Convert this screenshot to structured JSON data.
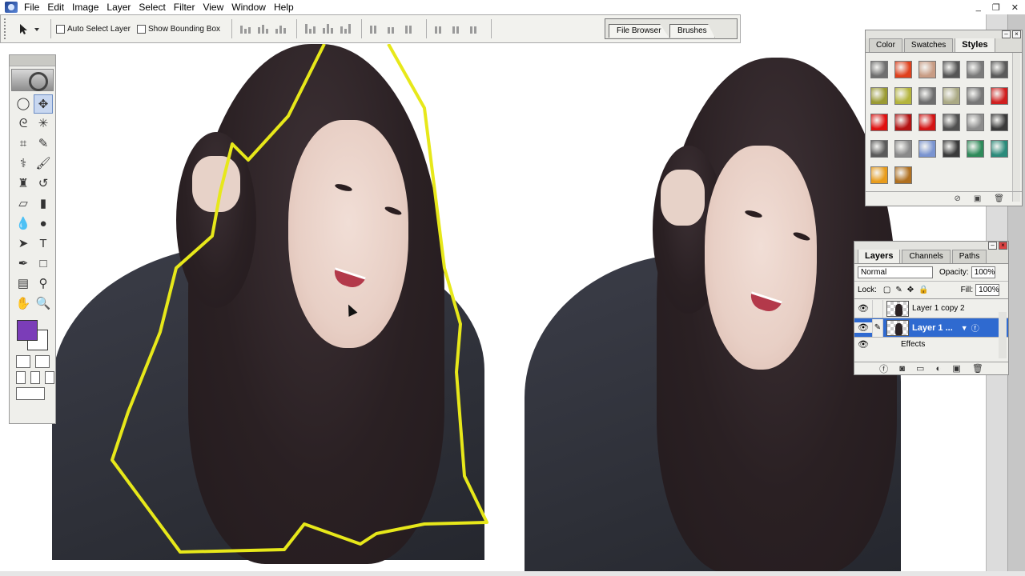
{
  "menubar": {
    "items": [
      "File",
      "Edit",
      "Image",
      "Layer",
      "Select",
      "Filter",
      "View",
      "Window",
      "Help"
    ],
    "window_controls": [
      "_",
      "❐",
      "✕"
    ]
  },
  "options_bar": {
    "auto_select_label": "Auto Select Layer",
    "auto_select_checked": false,
    "bounding_box_label": "Show Bounding Box",
    "bounding_box_checked": false,
    "well_tabs": [
      "File Browser",
      "Brushes"
    ]
  },
  "toolbox": {
    "tools": [
      "marquee",
      "move",
      "lasso",
      "magic-wand",
      "crop",
      "slice",
      "healing-brush",
      "brush",
      "clone-stamp",
      "history-brush",
      "eraser",
      "gradient",
      "blur",
      "dodge",
      "path-selection",
      "type",
      "pen",
      "shape",
      "notes",
      "eyedropper",
      "hand",
      "zoom"
    ],
    "active_tool": "move",
    "foreground_color": "#7b3db8",
    "background_color": "#ffffff"
  },
  "styles_panel": {
    "tabs": [
      "Color",
      "Swatches",
      "Styles"
    ],
    "active_tab": "Styles",
    "swatch_colors": [
      "#6f6f6f",
      "#e0401c",
      "#c89c84",
      "#555555",
      "#7a7a7a",
      "#5a5a5a",
      "#9a9a32",
      "#b4b43c",
      "#6e6e6e",
      "#aaa984",
      "#777777",
      "#d01e1e",
      "#e01010",
      "#b41414",
      "#d41414",
      "#505050",
      "#8c8c8c",
      "#3a3a3a",
      "#5a5a5a",
      "#8a8a8a",
      "#7a94d0",
      "#3a3a3a",
      "#2e8a5a",
      "#2a8a7a",
      "#e89c1c",
      "#b07020"
    ]
  },
  "layers_panel": {
    "tabs": [
      "Layers",
      "Channels",
      "Paths"
    ],
    "active_tab": "Layers",
    "blend_mode": "Normal",
    "opacity_label": "Opacity:",
    "opacity_value": "100%",
    "lock_label": "Lock:",
    "fill_label": "Fill:",
    "fill_value": "100%",
    "layers": [
      {
        "name": "Layer 1 copy 2",
        "selected": false
      },
      {
        "name": "Layer 1 ...",
        "selected": true
      }
    ],
    "effects_label": "Effects"
  }
}
